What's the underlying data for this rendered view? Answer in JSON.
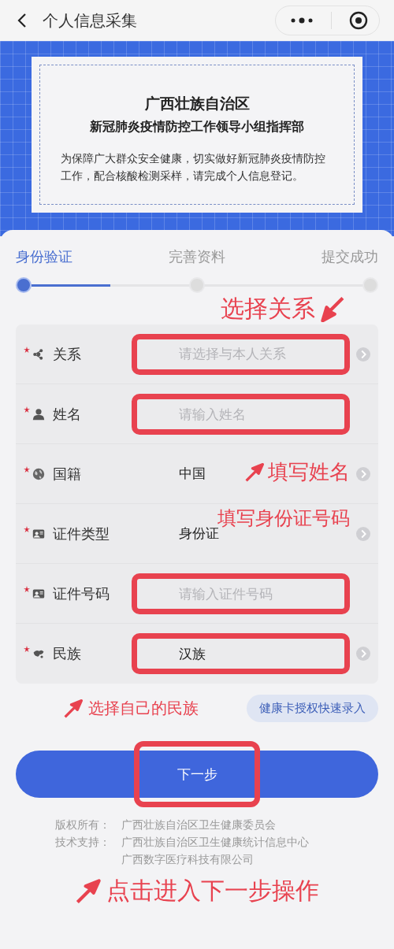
{
  "header": {
    "title": "个人信息采集"
  },
  "notice": {
    "title": "广西壮族自治区",
    "subtitle": "新冠肺炎疫情防控工作领导小组指挥部",
    "text": "为保障广大群众安全健康，切实做好新冠肺炎疫情防控工作，配合核酸检测采样，请完成个人信息登记。"
  },
  "steps": [
    {
      "label": "身份验证",
      "selected": true
    },
    {
      "label": "完善资料",
      "selected": false
    },
    {
      "label": "提交成功",
      "selected": false
    }
  ],
  "fields": [
    {
      "label": "关系",
      "required": true,
      "kind": "select",
      "placeholder": "请选择与本人关系",
      "highlighted": true
    },
    {
      "label": "姓名",
      "required": true,
      "kind": "input",
      "placeholder": "请输入姓名",
      "highlighted": true
    },
    {
      "label": "国籍",
      "required": true,
      "kind": "select",
      "value": "中国",
      "highlighted": false
    },
    {
      "label": "证件类型",
      "required": true,
      "kind": "select",
      "value": "身份证",
      "highlighted": false
    },
    {
      "label": "证件号码",
      "required": true,
      "kind": "input",
      "placeholder": "请输入证件号码",
      "highlighted": true
    },
    {
      "label": "民族",
      "required": true,
      "kind": "select",
      "value": "汉族",
      "highlighted": true
    }
  ],
  "quick_fill_button": "健康卡授权快速录入",
  "next_button": {
    "label": "下一步",
    "highlighted": true
  },
  "footer": [
    {
      "label": "版权所有：",
      "values": [
        "广西壮族自治区卫生健康委员会"
      ]
    },
    {
      "label": "技术支持：",
      "values": [
        "广西壮族自治区卫生健康统计信息中心",
        "广西数字医疗科技有限公司"
      ]
    }
  ],
  "annotations": [
    "选择关系",
    "填写姓名",
    "填写身份证号码",
    "选择自己的民族",
    "点击进入下一步操作"
  ]
}
